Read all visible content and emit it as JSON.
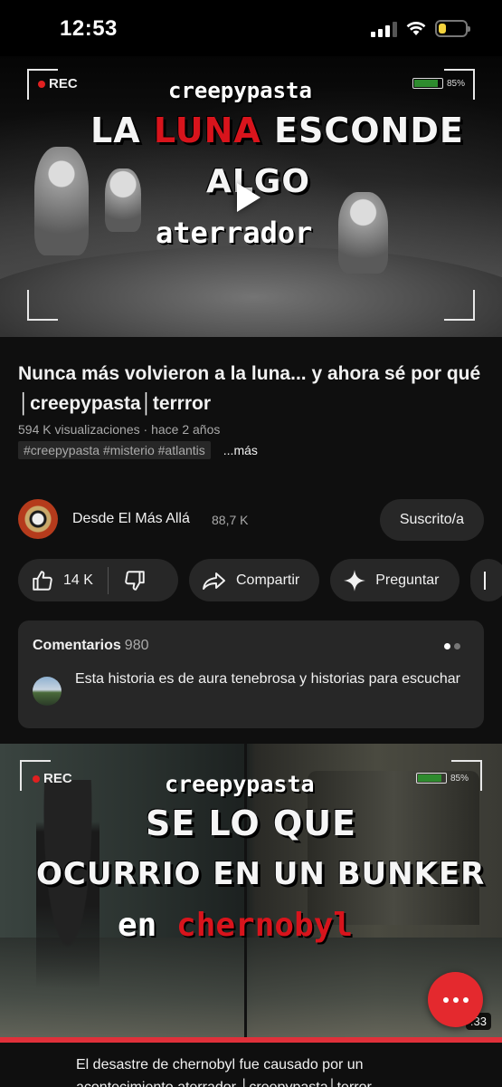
{
  "status_bar": {
    "time": "12:53",
    "signal_bars_active": 3,
    "battery_level": 0.3,
    "battery_color": "#f4d33d"
  },
  "video": {
    "thumbnail": {
      "rec_label": "REC",
      "battery_label": "85%",
      "overlay_top": "creepypasta",
      "overlay_line1_a": "LA ",
      "overlay_line1_red": "LUNA",
      "overlay_line1_b": " ESCONDE",
      "overlay_line2": "ALGO",
      "overlay_line3": "aterrador"
    },
    "title": "Nunca más volvieron a la luna... y ahora sé por qué │creepypasta│terrror",
    "meta": "594 K visualizaciones · hace 2 años",
    "tags": "#creepypasta #misterio #atlantis",
    "more_label": "...más"
  },
  "channel": {
    "name": "Desde El Más Allá",
    "subscribers": "88,7 K",
    "subscribe_label": "Suscrito/a"
  },
  "actions": {
    "like_count": "14 K",
    "share_label": "Compartir",
    "ask_label": "Preguntar"
  },
  "comments": {
    "label": "Comentarios",
    "count": "980",
    "top_comment": "Esta historia es de aura tenebrosa y historias para escuchar"
  },
  "next_video": {
    "thumbnail": {
      "rec_label": "REC",
      "battery_label": "85%",
      "overlay_top": "creepypasta",
      "overlay_line1": "SE LO QUE",
      "overlay_line2": "OCURRIO EN UN BUNKER",
      "overlay_line3_a": "en ",
      "overlay_line3_red": "chernobyl"
    },
    "duration": ":33",
    "title": "El desastre de chernobyl fue causado por un acontecimiento aterrador │creepypasta│terror"
  },
  "colors": {
    "background": "#0f0f0f",
    "surface": "#272727",
    "accent_red": "#e4292e"
  }
}
